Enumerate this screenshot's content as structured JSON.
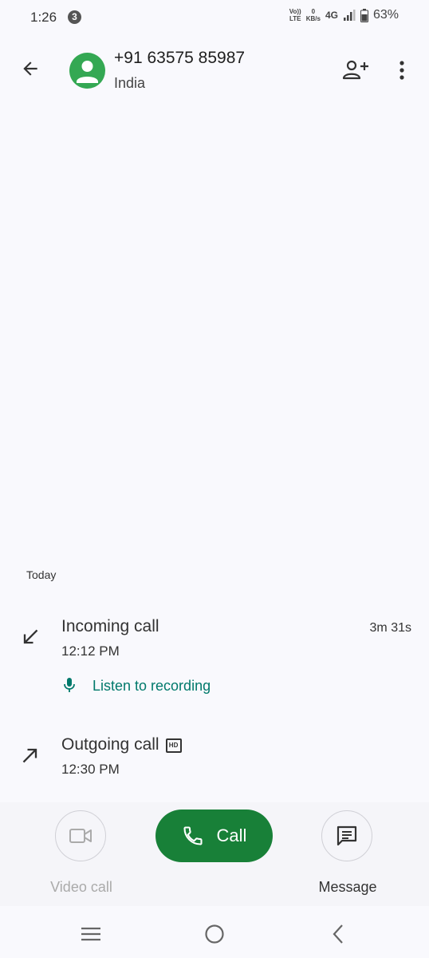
{
  "status_bar": {
    "time": "1:26",
    "notification_count": "3",
    "volte_top": "Vo))",
    "volte_bottom": "LTE",
    "speed_value": "0",
    "speed_unit": "KB/s",
    "network": "4G",
    "battery": "63%"
  },
  "header": {
    "contact_number": "+91 63575 85987",
    "contact_location": "India"
  },
  "history": {
    "section_label": "Today",
    "calls": [
      {
        "type": "Incoming call",
        "time": "12:12 PM",
        "duration": "3m 31s",
        "recording_label": "Listen to recording"
      },
      {
        "type": "Outgoing call",
        "time": "12:30 PM",
        "hd_badge": "HD"
      }
    ]
  },
  "actions": {
    "video_call_label": "Video call",
    "call_label": "Call",
    "message_label": "Message"
  },
  "colors": {
    "accent_green": "#188038",
    "avatar_green": "#34a853",
    "recording_teal": "#00796b"
  }
}
